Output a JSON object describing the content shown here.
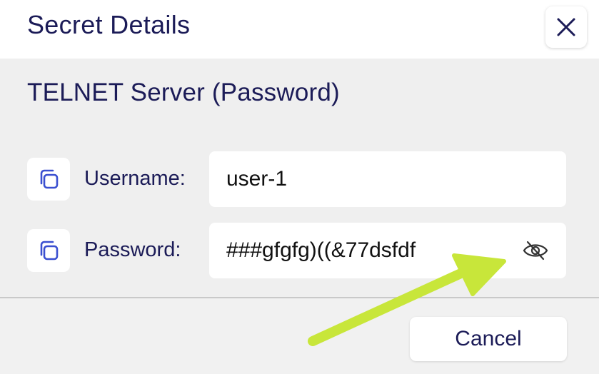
{
  "dialog": {
    "title": "Secret Details",
    "secret_name": "TELNET Server (Password)",
    "fields": [
      {
        "label": "Username:",
        "value": "user-1"
      },
      {
        "label": "Password:",
        "value": "###gfgfg)((&77dsfdf"
      }
    ],
    "cancel_label": "Cancel"
  },
  "icons": {
    "close": "close-icon",
    "copy": "copy-icon",
    "visibility": "eye-off-icon"
  },
  "annotation": {
    "arrow_color": "#c8e63a"
  },
  "colors": {
    "text": "#1b1b57",
    "accent": "#3a4fd0"
  }
}
